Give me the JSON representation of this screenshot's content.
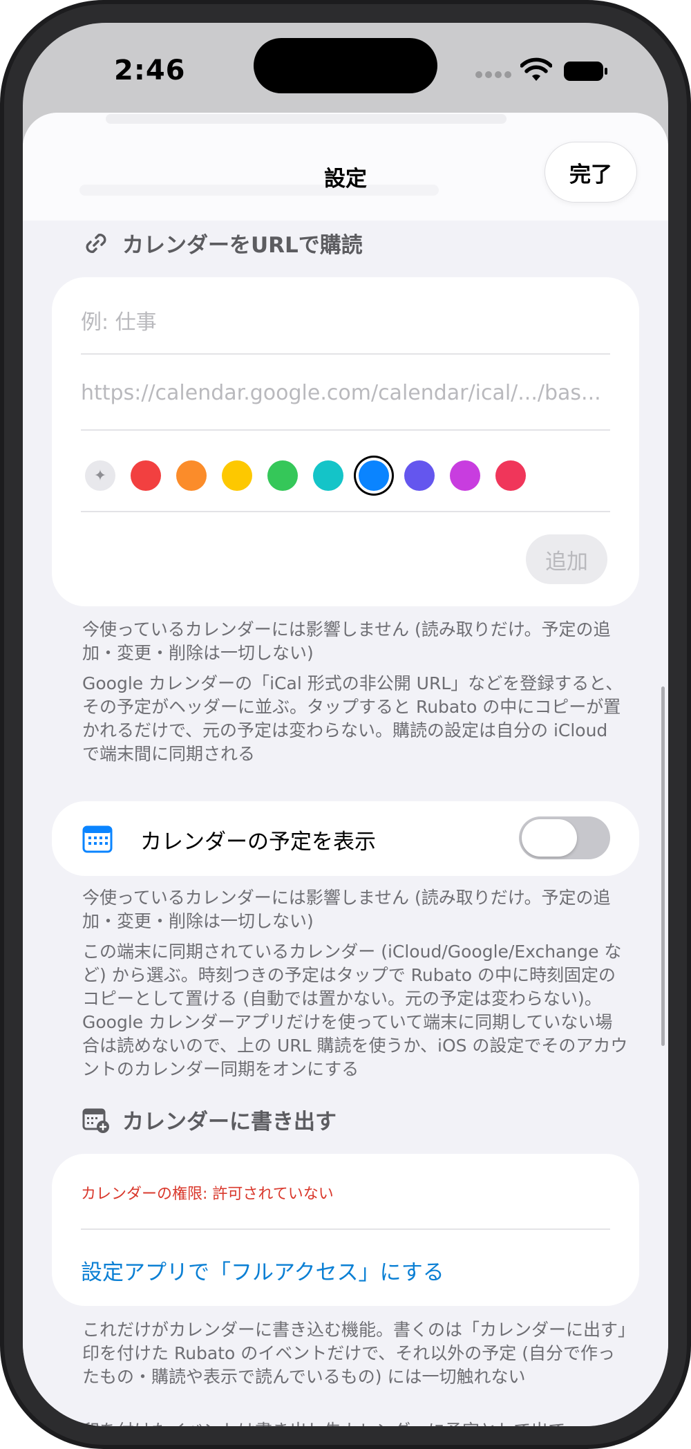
{
  "status_bar": {
    "time": "2:46"
  },
  "nav": {
    "title": "設定",
    "done_label": "完了"
  },
  "subscribe_section": {
    "header": "カレンダーをURLで購読",
    "name_placeholder": "例: 仕事",
    "url_placeholder": "https://calendar.google.com/calendar/ical/.../bas...",
    "colors": [
      "#f24040",
      "#fb8c2a",
      "#fdc800",
      "#35c759",
      "#14c4c8",
      "#0a84ff",
      "#6456ee",
      "#c83ddf",
      "#f0365a"
    ],
    "selected_color": "#0a84ff",
    "add_label": "追加",
    "footnote_1": "今使っているカレンダーには影響しません (読み取りだけ。予定の追加・変更・削除は一切しない)",
    "footnote_2": "Google カレンダーの「iCal 形式の非公開 URL」などを登録すると、その予定がヘッダーに並ぶ。タップすると Rubato の中にコピーが置かれるだけで、元の予定は変わらない。購読の設定は自分の iCloud で端末間に同期される"
  },
  "show_events": {
    "label": "カレンダーの予定を表示",
    "enabled": false,
    "footnote_1": "今使っているカレンダーには影響しません (読み取りだけ。予定の追加・変更・削除は一切しない)",
    "footnote_2": "この端末に同期されているカレンダー (iCloud/Google/Exchange など) から選ぶ。時刻つきの予定はタップで Rubato の中に時刻固定のコピーとして置ける (自動では置かない。元の予定は変わらない)。Google カレンダーアプリだけを使っていて端末に同期していない場合は読めないので、上の URL 購読を使うか、iOS の設定でそのアカウントのカレンダー同期をオンにする"
  },
  "export_section": {
    "header": "カレンダーに書き出す",
    "permission_status": "カレンダーの権限: 許可されていない",
    "open_settings_label": "設定アプリで「フルアクセス」にする",
    "footnote_1": "これだけがカレンダーに書き込む機能。書くのは「カレンダーに出す」印を付けた Rubato のイベントだけで、それ以外の予定 (自分で作ったもの・購読や表示で読んでいるもの) には一切触れない",
    "footnote_2": "印を付けたイベントは書き出し先カレンダーに予定として出て、Rubato で動かせば追従し、完了で実績の時間帯に確定する。オフにすると書き出した予定はすべて消える"
  }
}
